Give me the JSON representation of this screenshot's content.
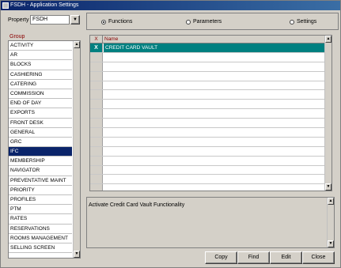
{
  "window": {
    "title": "FSDH - Application Settings"
  },
  "property": {
    "label": "Property",
    "value": "FSDH",
    "dropdown_icon": "chevron-down-icon"
  },
  "view_options": {
    "functions": {
      "label": "Functions",
      "selected": true
    },
    "parameters": {
      "label": "Parameters",
      "selected": false
    },
    "settings": {
      "label": "Settings",
      "selected": false
    }
  },
  "group": {
    "label": "Group",
    "items": [
      "ACTIVITY",
      "AR",
      "BLOCKS",
      "CASHIERING",
      "CATERING",
      "COMMISSION",
      "END OF DAY",
      "EXPORTS",
      "FRONT DESK",
      "GENERAL",
      "GRC",
      "IFC",
      "MEMBERSHIP",
      "NAVIGATOR",
      "PREVENTATIVE MAINT",
      "PRIORITY",
      "PROFILES",
      "PTM",
      "RATES",
      "RESERVATIONS",
      "ROOMS MANAGEMENT",
      "SELLING SCREEN"
    ],
    "selected": "IFC"
  },
  "grid": {
    "headers": {
      "x": "X",
      "name": "Name"
    },
    "rows": [
      {
        "x": "X",
        "name": "CREDIT CARD VAULT",
        "selected": true
      }
    ]
  },
  "description": "Activate Credit Card Vault Functionality",
  "buttons": {
    "copy": "Copy",
    "find": "Find",
    "edit": "Edit",
    "close": "Close"
  }
}
